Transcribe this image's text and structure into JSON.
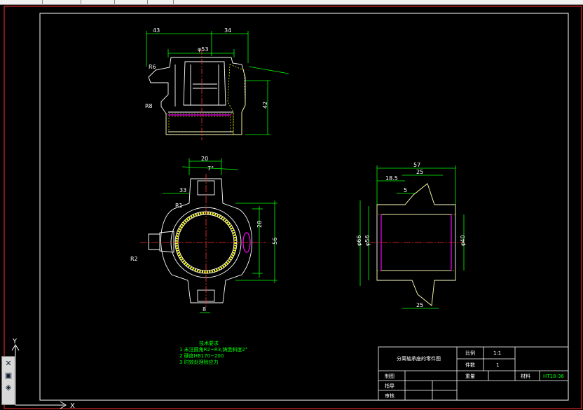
{
  "title_block": {
    "part_name": "分离轴承座的零件图",
    "scale_label": "比例",
    "scale_value": "1:1",
    "count_label": "件数",
    "count_value": "1",
    "drawn_label": "制图",
    "weight_label": "重量",
    "material_label": "材料",
    "material_value": "HT18-36",
    "instructor_label": "指导",
    "review_label": "审核"
  },
  "tech_notes": {
    "heading": "技术要求",
    "lines": [
      "1  未注圆角R2~R3,铸造斜度2°",
      "2  硬度HB170~200",
      "3  时效处理除应力"
    ]
  },
  "dims_top": {
    "a": "43",
    "b": "34",
    "dia": "φ53",
    "h": "42",
    "r1": "R6",
    "r2": "R8"
  },
  "dims_front": {
    "w": "20",
    "ang": "7°",
    "w33": "33",
    "h28": "28",
    "h56": "56",
    "w8": "8",
    "r2": "R2",
    "r1": "R1"
  },
  "dims_side": {
    "w57": "57",
    "w25t": "25",
    "w185": "18.5",
    "w5": "5",
    "w25b": "25",
    "d66": "φ66",
    "d56": "φ56",
    "d40": "φ40"
  },
  "ucs": {
    "x": "X",
    "y": "Y"
  },
  "icons": [
    "close-icon",
    "save-icon",
    "nav-icon"
  ]
}
